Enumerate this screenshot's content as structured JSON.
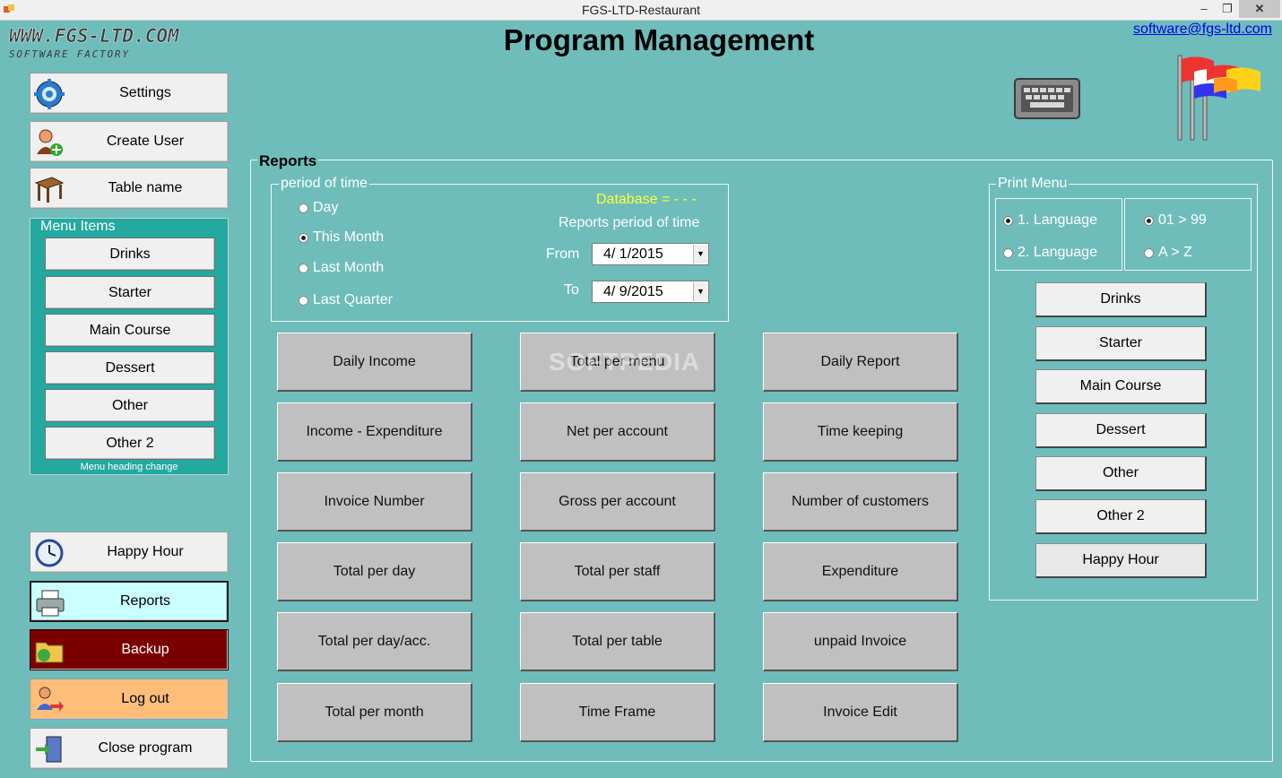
{
  "window": {
    "title": "FGS-LTD-Restaurant",
    "minimize": "–",
    "maximize": "❐",
    "close": "✕"
  },
  "header": {
    "logo_text": "WWW.FGS-LTD.COM",
    "logo_sub": "SOFTWARE FACTORY",
    "title": "Program Management",
    "email": "software@fgs-ltd.com",
    "keyboard_icon": "keyboard-icon",
    "language_icon": "flags-icon"
  },
  "sidebar": {
    "top_buttons": [
      {
        "label": "Settings",
        "icon": "gear-icon"
      },
      {
        "label": "Create User",
        "icon": "user-add-icon"
      },
      {
        "label": "Table name",
        "icon": "table-icon"
      }
    ],
    "menu_items": {
      "legend": "Menu Items",
      "items": [
        "Drinks",
        "Starter",
        "Main Course",
        "Dessert",
        "Other",
        "Other 2"
      ],
      "footer": "Menu heading change"
    },
    "bottom_buttons": [
      {
        "label": "Happy Hour",
        "icon": "clock-icon",
        "bg": "#f0f0f0",
        "color": "#000000"
      },
      {
        "label": "Reports",
        "icon": "printer-icon",
        "bg": "#c9ffff",
        "color": "#000000"
      },
      {
        "label": "Backup",
        "icon": "folder-icon",
        "bg": "#7a0000",
        "color": "#ffffff"
      },
      {
        "label": "Log out",
        "icon": "logout-icon",
        "bg": "#ffbd7a",
        "color": "#000000"
      },
      {
        "label": "Close program",
        "icon": "exit-door-icon",
        "bg": "#f0f0f0",
        "color": "#000000"
      }
    ]
  },
  "reports": {
    "title": "Reports",
    "period": {
      "legend": "period of time",
      "options": [
        "Day",
        "This Month",
        "Last Month",
        "Last Quarter"
      ],
      "selected": "This Month",
      "database_text": "Database =  - - -",
      "reports_period_text": "Reports period of time",
      "from_label": "From",
      "from_value": "4/  1/2015",
      "to_label": "To",
      "to_value": "4/  9/2015"
    },
    "buttons": [
      [
        "Daily Income",
        "Total per menu",
        "Daily Report"
      ],
      [
        "Income - Expenditure",
        "Net per account",
        "Time keeping"
      ],
      [
        "Invoice Number",
        "Gross per account",
        "Number of customers"
      ],
      [
        "Total per day",
        "Total per staff",
        "Expenditure"
      ],
      [
        "Total per day/acc.",
        "Total per table",
        "unpaid Invoice"
      ],
      [
        "Total per month",
        "Time Frame",
        "Invoice Edit"
      ]
    ],
    "watermark": "SOFTPEDIA"
  },
  "print_menu": {
    "legend": "Print Menu",
    "language_options": [
      "1. Language",
      "2. Language"
    ],
    "language_selected": "1. Language",
    "sort_options": [
      "01 > 99",
      "A > Z"
    ],
    "sort_selected": "01 > 99",
    "buttons": [
      "Drinks",
      "Starter",
      "Main Course",
      "Dessert",
      "Other",
      "Other 2",
      "Happy Hour"
    ]
  }
}
